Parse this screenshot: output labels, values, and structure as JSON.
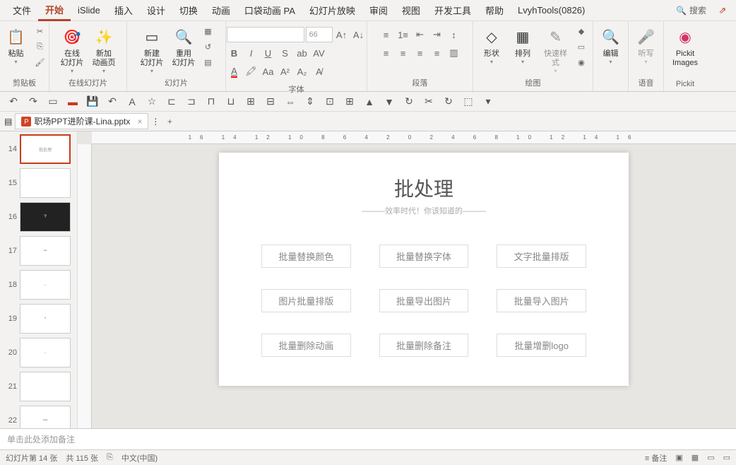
{
  "menu": {
    "tabs": [
      "文件",
      "开始",
      "iSlide",
      "插入",
      "设计",
      "切换",
      "动画",
      "口袋动画 PA",
      "幻灯片放映",
      "审阅",
      "视图",
      "开发工具",
      "帮助",
      "LvyhTools(0826)"
    ],
    "active": 1,
    "search": "搜索"
  },
  "ribbon": {
    "clipboard": {
      "label": "剪贴板",
      "paste": "粘贴"
    },
    "online": {
      "label": "在线幻灯片",
      "btn1": "在线\n幻灯片",
      "btn2": "新加\n动画页"
    },
    "slides": {
      "label": "幻灯片",
      "btn1": "新建\n幻灯片",
      "btn2": "重用\n幻灯片"
    },
    "font": {
      "label": "字体",
      "size": "66"
    },
    "para": {
      "label": "段落"
    },
    "draw": {
      "label": "绘图",
      "shape": "形状",
      "arrange": "排列",
      "quick": "快速样式"
    },
    "edit": {
      "label": "编辑",
      "btn": "编辑"
    },
    "voice": {
      "label": "语音",
      "btn": "听写"
    },
    "pickit": {
      "label": "Pickit",
      "btn": "Pickit\nImages"
    }
  },
  "doc": {
    "name": "职场PPT进阶课-Lina.pptx"
  },
  "thumbs": [
    14,
    15,
    16,
    17,
    18,
    19,
    20,
    21,
    22
  ],
  "slide": {
    "title": "批处理",
    "sub": "———效率时代！你该知道的———",
    "cells": [
      "批量替换颜色",
      "批量替换字体",
      "文字批量排版",
      "图片批量排版",
      "批量导出图片",
      "批量导入图片",
      "批量删除动画",
      "批量删除备注",
      "批量增删logo"
    ]
  },
  "notes": "单击此处添加备注",
  "status": {
    "slide": "幻灯片第 14 张",
    "total": "共 115 张",
    "lang": "中文(中国)",
    "notes_btn": "备注"
  },
  "ruler": "16 14 12 10 8 6 4 2 0 2 4 6 8 10 12 14 16"
}
